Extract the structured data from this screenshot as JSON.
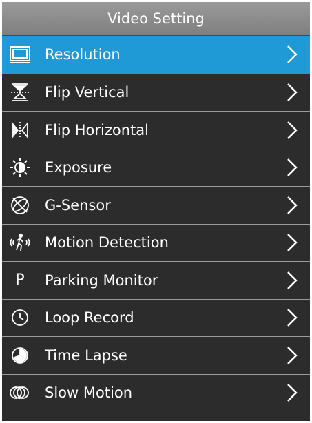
{
  "header": {
    "title": "Video Setting"
  },
  "accent_color": "#1f9ad6",
  "menu": {
    "items": [
      {
        "label": "Resolution",
        "icon": "resolution-icon",
        "selected": true
      },
      {
        "label": "Flip Vertical",
        "icon": "flip-vertical-icon"
      },
      {
        "label": "Flip Horizontal",
        "icon": "flip-horizontal-icon"
      },
      {
        "label": "Exposure",
        "icon": "exposure-icon"
      },
      {
        "label": "G-Sensor",
        "icon": "g-sensor-icon"
      },
      {
        "label": "Motion Detection",
        "icon": "motion-detection-icon"
      },
      {
        "label": "Parking Monitor",
        "icon": "parking-monitor-icon",
        "glyph": "P"
      },
      {
        "label": "Loop Record",
        "icon": "loop-record-icon"
      },
      {
        "label": "Time Lapse",
        "icon": "time-lapse-icon"
      },
      {
        "label": "Slow Motion",
        "icon": "slow-motion-icon"
      }
    ]
  }
}
